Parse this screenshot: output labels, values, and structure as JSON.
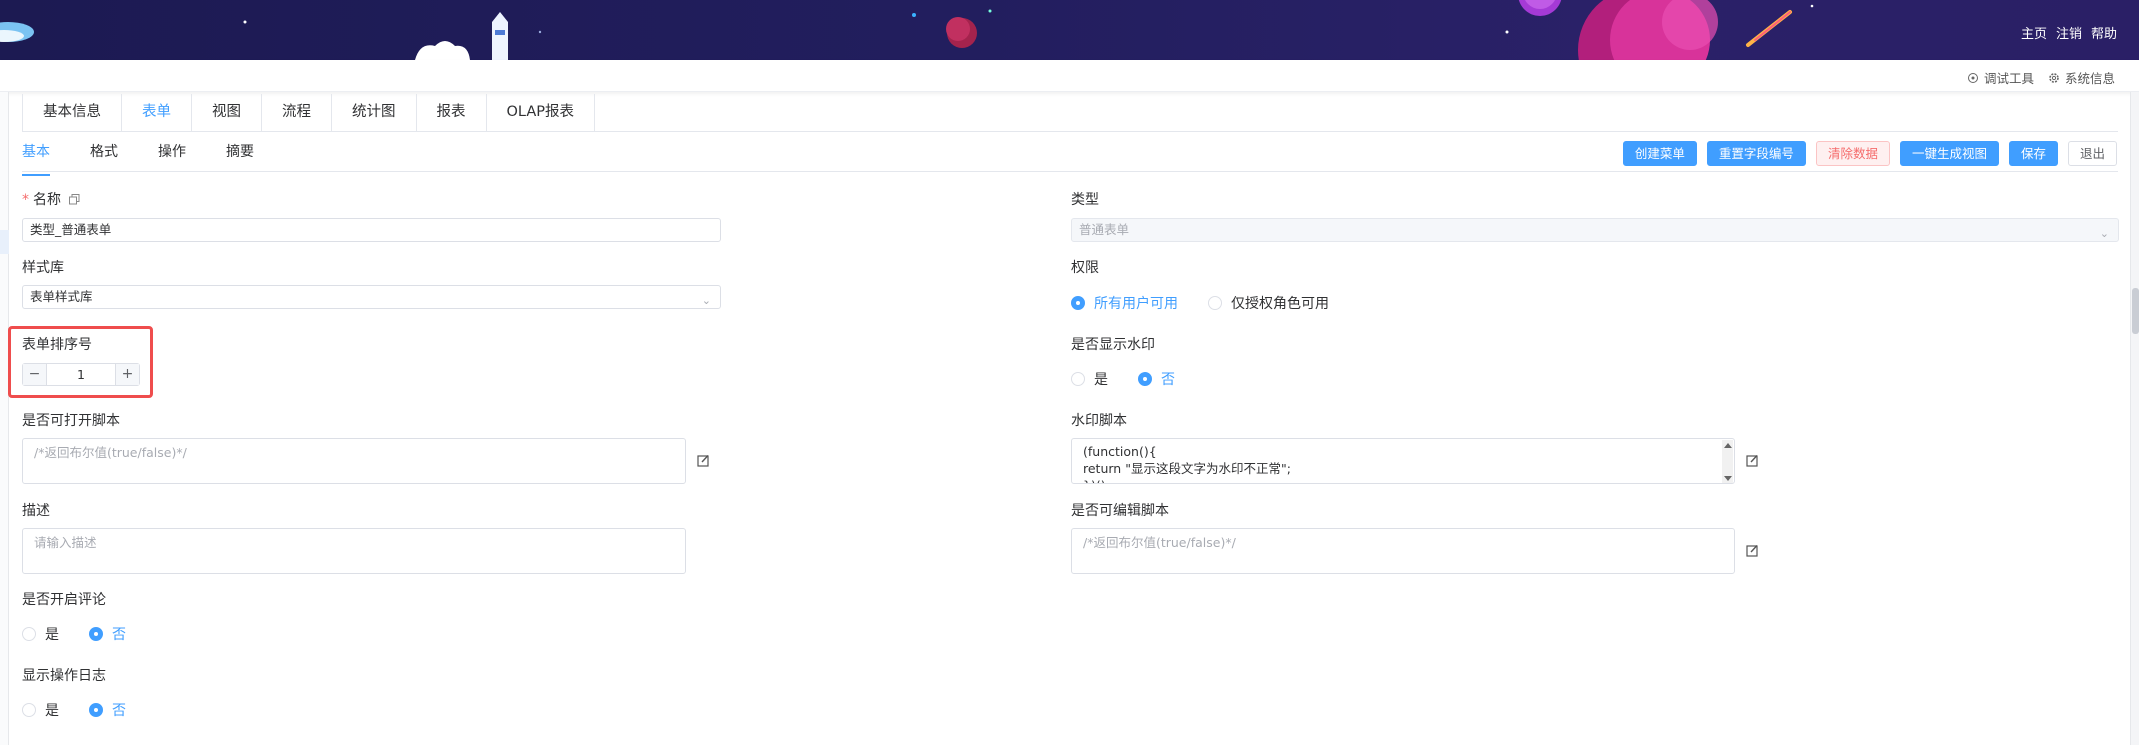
{
  "header": {
    "links": [
      "主页",
      "注销",
      "帮助"
    ]
  },
  "subheader": {
    "debug_tool": "调试工具",
    "system_info": "系统信息"
  },
  "tabs_main": [
    {
      "label": "基本信息",
      "active": false
    },
    {
      "label": "表单",
      "active": true
    },
    {
      "label": "视图",
      "active": false
    },
    {
      "label": "流程",
      "active": false
    },
    {
      "label": "统计图",
      "active": false
    },
    {
      "label": "报表",
      "active": false
    },
    {
      "label": "OLAP报表",
      "active": false
    }
  ],
  "tabs_sub": [
    {
      "label": "基本",
      "active": true
    },
    {
      "label": "格式",
      "active": false
    },
    {
      "label": "操作",
      "active": false
    },
    {
      "label": "摘要",
      "active": false
    }
  ],
  "actions": {
    "create_menu": "创建菜单",
    "reset_field_no": "重置字段编号",
    "clear_data": "清除数据",
    "generate_view": "一键生成视图",
    "save": "保存",
    "exit": "退出"
  },
  "form": {
    "name": {
      "label": "名称",
      "value": "类型_普通表单"
    },
    "type": {
      "label": "类型",
      "value": "普通表单"
    },
    "style_lib": {
      "label": "样式库",
      "value": "表单样式库"
    },
    "permission": {
      "label": "权限",
      "options": [
        "所有用户可用",
        "仅授权角色可用"
      ],
      "selected": "所有用户可用"
    },
    "sort_no": {
      "label": "表单排序号",
      "value": "1"
    },
    "show_watermark": {
      "label": "是否显示水印",
      "options": [
        "是",
        "否"
      ],
      "selected": "否"
    },
    "open_script": {
      "label": "是否可打开脚本",
      "placeholder": "/*返回布尔值(true/false)*/"
    },
    "watermark_script": {
      "label": "水印脚本",
      "lines": [
        "(function(){",
        "return \"显示这段文字为水印不正常\";",
        "})()"
      ]
    },
    "description": {
      "label": "描述",
      "placeholder": "请输入描述"
    },
    "edit_script": {
      "label": "是否可编辑脚本",
      "placeholder": "/*返回布尔值(true/false)*/"
    },
    "enable_comment": {
      "label": "是否开启评论",
      "options": [
        "是",
        "否"
      ],
      "selected": "否"
    },
    "show_log": {
      "label": "显示操作日志",
      "options": [
        "是",
        "否"
      ],
      "selected": "否"
    }
  },
  "colors": {
    "primary": "#409eff",
    "danger": "#f56c6c",
    "highlight": "#ef4d4d",
    "banner": "#1c1a52"
  }
}
